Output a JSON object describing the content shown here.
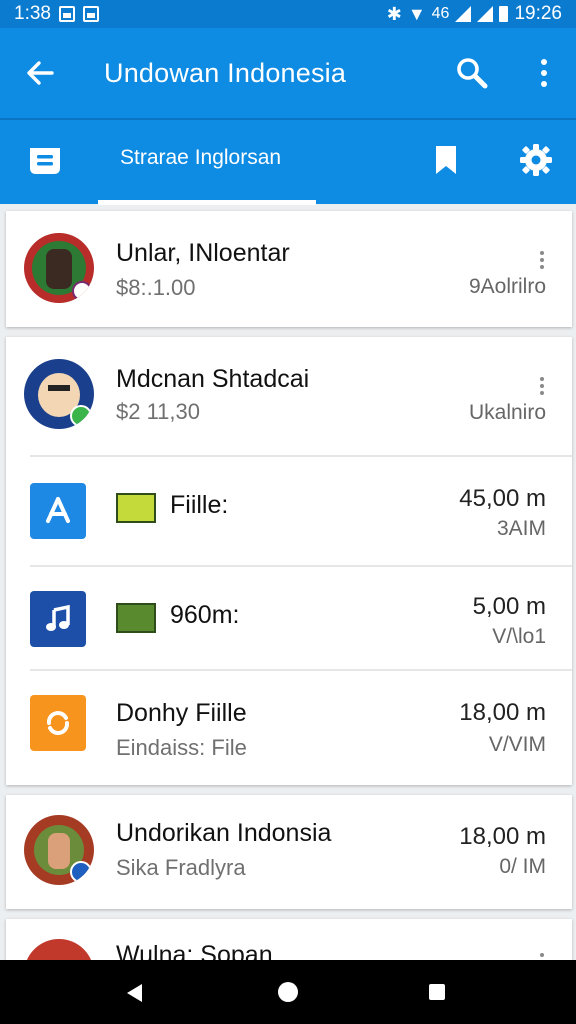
{
  "status_bar": {
    "time_left": "1:38",
    "time_right": "19:26",
    "net_label": "46"
  },
  "app_bar": {
    "title": "Undowan Indonesia",
    "back_icon": "arrow-left-icon",
    "search_icon": "search-icon",
    "more_icon": "more-vertical-icon"
  },
  "tabs": {
    "active_label": "Strarae Inglorsan",
    "left_icon": "message-icon",
    "bookmark_icon": "bookmark-icon",
    "settings_icon": "settings-gear-icon"
  },
  "items": [
    {
      "name": "Unlar, INloentar",
      "sub": "$8:.1.00",
      "right": "9Aolrilro"
    },
    {
      "name": "Mdcnan Shtadcai",
      "sub": "$2 11,30",
      "right": "Ukalniro"
    },
    {
      "name": "Fiille:",
      "amount": "45,00 m",
      "meta": "3AIM"
    },
    {
      "name": "960m:",
      "amount": "5,00 m",
      "meta": "V/\\lo1"
    },
    {
      "name": "Donhy Fiille",
      "sub": "Eindaiss: File",
      "amount": "18,00 m",
      "meta": "V/VIM"
    },
    {
      "name": "Undorikan Indonsia",
      "sub": "Sika Fradlyra",
      "amount": "18,00 m",
      "meta": "0/ IM"
    },
    {
      "name": "Wulna: Sopan"
    }
  ],
  "colors": {
    "app_bar": "#0e8be3",
    "status_bar": "#0b7bd0",
    "app_store_blue": "#1e88e5",
    "music_blue": "#1d4fa8",
    "orange": "#f7941d"
  }
}
